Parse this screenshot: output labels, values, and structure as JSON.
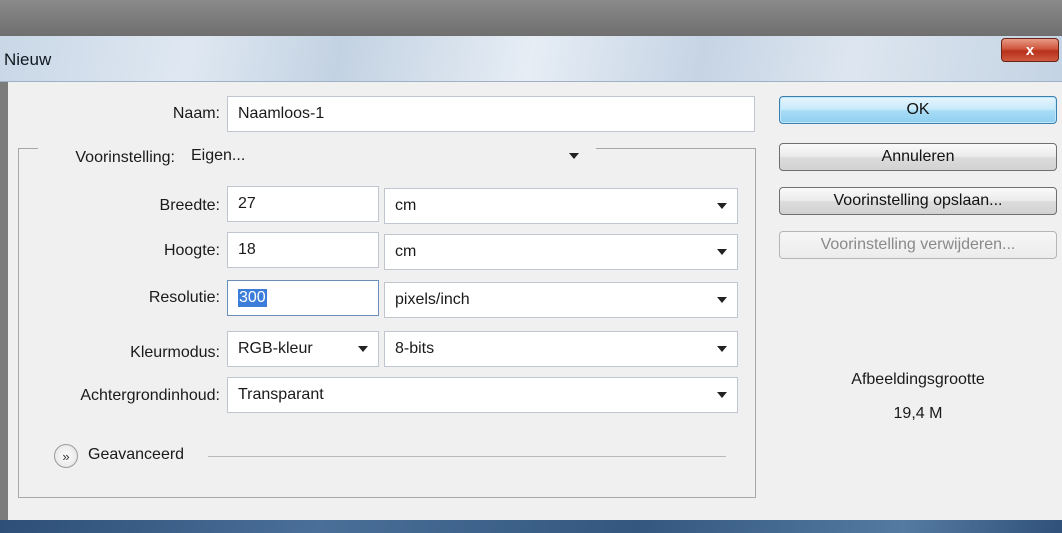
{
  "window": {
    "title": "Nieuw",
    "close_glyph": "x"
  },
  "form": {
    "name_label": "Naam:",
    "name_value": "Naamloos-1",
    "preset_label": "Voorinstelling:",
    "preset_value": "Eigen...",
    "width_label": "Breedte:",
    "width_value": "27",
    "width_unit": "cm",
    "height_label": "Hoogte:",
    "height_value": "18",
    "height_unit": "cm",
    "resolution_label": "Resolutie:",
    "resolution_value": "300",
    "resolution_unit": "pixels/inch",
    "colormode_label": "Kleurmodus:",
    "colormode_value": "RGB-kleur",
    "bitdepth_value": "8-bits",
    "background_label": "Achtergrondinhoud:",
    "background_value": "Transparant",
    "advanced_label": "Geavanceerd"
  },
  "buttons": {
    "ok": "OK",
    "cancel": "Annuleren",
    "save_preset": "Voorinstelling opslaan...",
    "delete_preset": "Voorinstelling verwijderen..."
  },
  "image_size": {
    "label": "Afbeeldingsgrootte",
    "value": "19,4 M"
  },
  "icons": {
    "dropdown": "chevron-down-icon",
    "advanced": "double-chevron-down-icon",
    "close": "close-icon"
  },
  "colors": {
    "ok_button": "#a9dcf6",
    "selection": "#3b7dd8",
    "close_button": "#c0392b"
  }
}
